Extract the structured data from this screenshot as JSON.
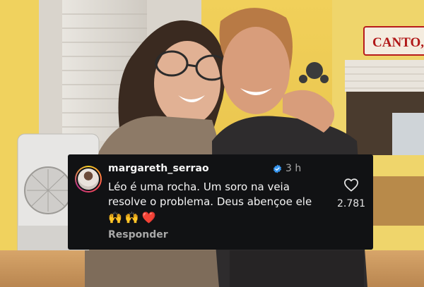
{
  "background_sign": {
    "text": "CANTO, E"
  },
  "comment": {
    "username": "margareth_serrao",
    "time": "3 h",
    "text_line1": "Léo é uma rocha. Um soro na veia",
    "text_line2": "resolve o problema. Deus abençoe ele",
    "emojis": [
      "🙌",
      "🙌",
      "❤️"
    ],
    "reply_label": "Responder",
    "likes": "2.781",
    "icons": {
      "verified": "verified-badge-icon",
      "like": "heart-outline-icon"
    },
    "colors": {
      "card_bg": "#111214",
      "verified": "#3897f0",
      "muted": "#a8a8a8",
      "heart": "#ff3040"
    }
  }
}
